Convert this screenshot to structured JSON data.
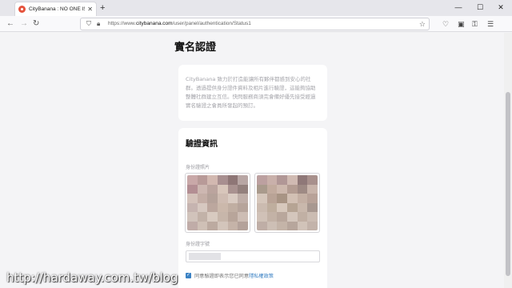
{
  "browser": {
    "tab_title": "CityBanana : NO ONE IS ALONE",
    "tab_close": "✕",
    "new_tab": "+",
    "window_controls": {
      "minimize": "—",
      "maximize": "☐",
      "close": "✕"
    },
    "url_prefix": "https://www.",
    "url_domain": "citybanana.com",
    "url_path": "/user/panel/authentication/Status1"
  },
  "page": {
    "title": "實名認證",
    "intro_text": "CityBanana 致力於打造能讓所有夥伴都感到安心的社群。透過提供身分證件資料及相片進行驗證，這能夠協助整體社群建立互信。快閃服務商須完會備好優先接受經過實名驗證之會員所發起的預訂。",
    "verify": {
      "title": "驗證資訊",
      "id_photo_label": "身份證照片",
      "id_number_label": "身份證字號",
      "agree_text": "同意驗證即表示您已同意",
      "privacy_link": "隱私權政策",
      "agree_checked": true
    }
  },
  "watermark": "http://hardaway.com.tw/blog",
  "colors": {
    "accent": "#3b82c4",
    "favicon": "#e5533d"
  }
}
